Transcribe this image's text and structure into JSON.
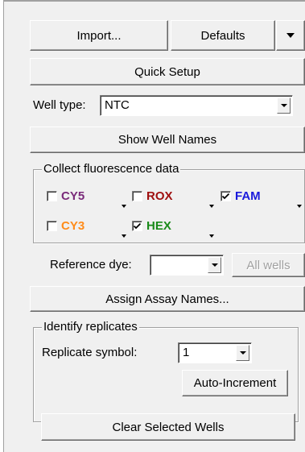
{
  "buttons": {
    "import_label": "Import...",
    "defaults_label": "Defaults",
    "quick_setup_label": "Quick Setup",
    "show_well_names_label": "Show Well Names",
    "all_wells_label": "All wells",
    "assign_assay_names_label": "Assign Assay Names...",
    "auto_increment_label": "Auto-Increment",
    "clear_selected_wells_label": "Clear Selected Wells"
  },
  "well_type": {
    "label": "Well type:",
    "value": "NTC"
  },
  "fluorescence": {
    "group_label": "Collect fluorescence data",
    "dyes": [
      {
        "name": "CY5",
        "checked": false,
        "color": "#7a2a7a"
      },
      {
        "name": "ROX",
        "checked": false,
        "color": "#a01010"
      },
      {
        "name": "FAM",
        "checked": true,
        "color": "#1a1adc"
      },
      {
        "name": "CY3",
        "checked": false,
        "color": "#ff8c1a"
      },
      {
        "name": "HEX",
        "checked": true,
        "color": "#1a8a1a"
      }
    ]
  },
  "reference_dye": {
    "label": "Reference dye:",
    "value": ""
  },
  "replicates": {
    "group_label": "Identify replicates",
    "symbol_label": "Replicate symbol:",
    "symbol_value": "1"
  }
}
